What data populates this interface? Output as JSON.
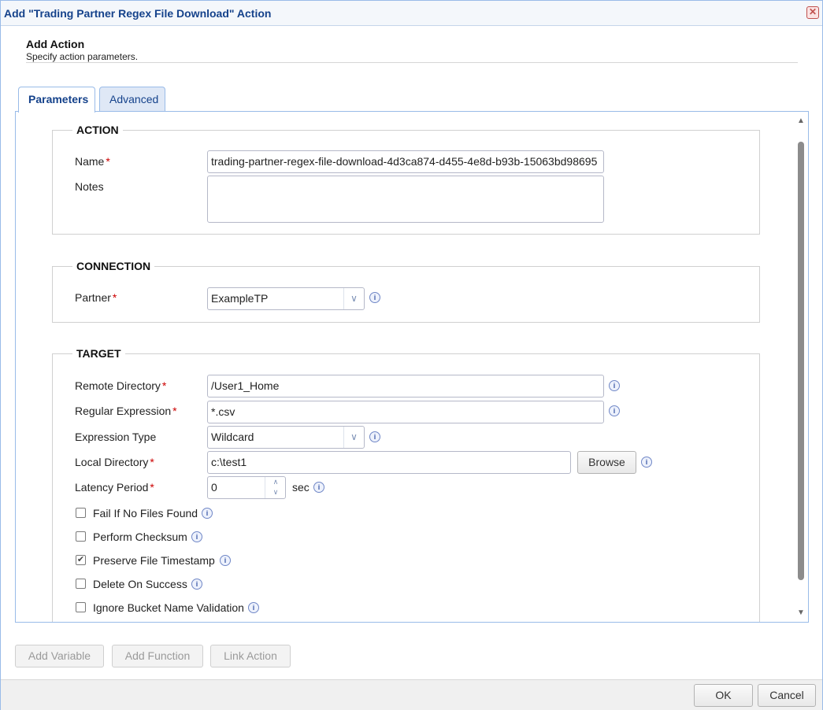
{
  "window": {
    "title": "Add \"Trading Partner Regex File Download\" Action",
    "close_symbol": "✕"
  },
  "header": {
    "title": "Add Action",
    "subtitle": "Specify action parameters."
  },
  "tabs": [
    {
      "label": "Parameters",
      "active": true
    },
    {
      "label": "Advanced",
      "active": false
    }
  ],
  "action": {
    "legend": "ACTION",
    "name_label": "Name",
    "name_value": "trading-partner-regex-file-download-4d3ca874-d455-4e8d-b93b-15063bd98695",
    "notes_label": "Notes",
    "notes_value": ""
  },
  "connection": {
    "legend": "CONNECTION",
    "partner_label": "Partner",
    "partner_value": "ExampleTP"
  },
  "target": {
    "legend": "TARGET",
    "remote_dir_label": "Remote Directory",
    "remote_dir_value": "/User1_Home",
    "regex_label": "Regular Expression",
    "regex_value": "*.csv",
    "expr_type_label": "Expression Type",
    "expr_type_value": "Wildcard",
    "local_dir_label": "Local Directory",
    "local_dir_value": "c:\\test1",
    "browse_label": "Browse",
    "latency_label": "Latency Period",
    "latency_value": "0",
    "latency_unit": "sec",
    "checkboxes": [
      {
        "label": "Fail If No Files Found",
        "checked": false
      },
      {
        "label": "Perform Checksum",
        "checked": false
      },
      {
        "label": "Preserve File Timestamp",
        "checked": true
      },
      {
        "label": "Delete On Success",
        "checked": false
      },
      {
        "label": "Ignore Bucket Name Validation",
        "checked": false
      }
    ]
  },
  "required_marker": "*",
  "bottom_buttons": {
    "add_variable": "Add Variable",
    "add_function": "Add Function",
    "link_action": "Link Action"
  },
  "footer": {
    "ok": "OK",
    "cancel": "Cancel"
  },
  "icons": {
    "info": "info-icon",
    "close": "close-icon",
    "dropdown": "chevron-down-icon",
    "check": "checkmark-icon",
    "scroll_up": "scroll-up-arrow-icon",
    "scroll_down": "scroll-down-arrow-icon"
  },
  "colors": {
    "accent": "#15428b",
    "border": "#99bbe8",
    "required": "#cc0000"
  }
}
